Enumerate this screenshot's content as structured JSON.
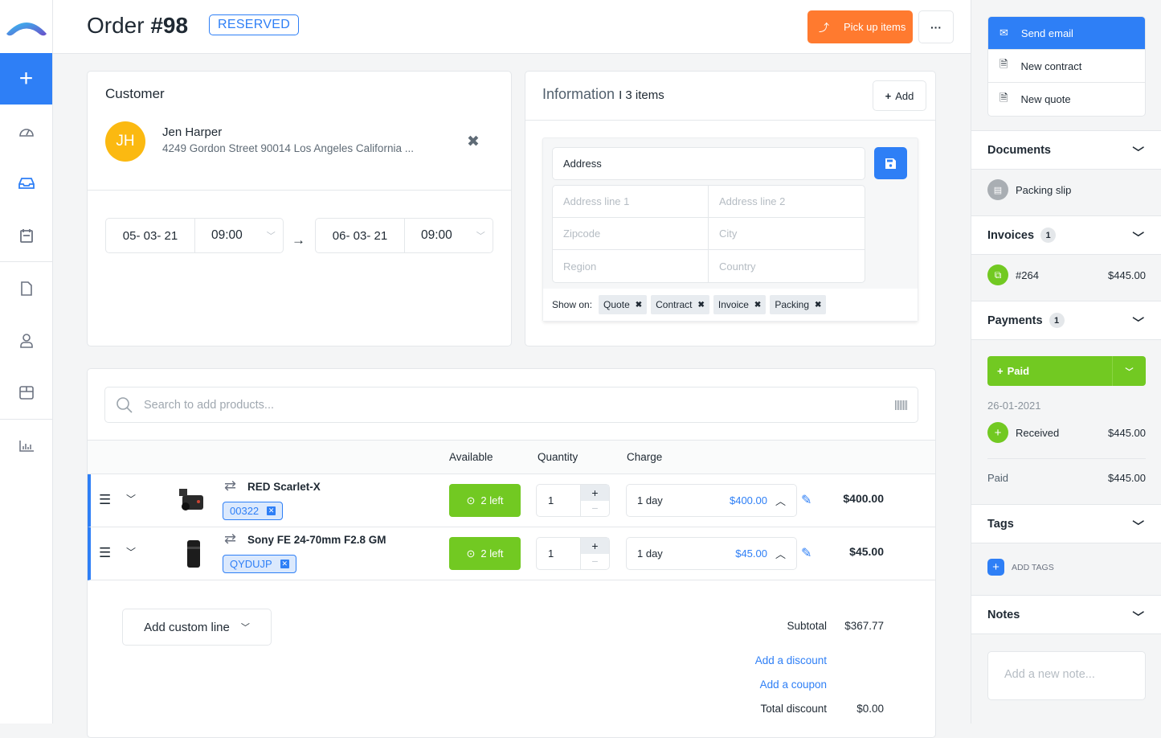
{
  "header": {
    "title_prefix": "Order",
    "title_number": "#98",
    "status": "RESERVED",
    "pickup_label": "Pick up items",
    "more_label": "···"
  },
  "sidebar": {
    "new_label": "+",
    "items": [
      "dashboard",
      "orders",
      "calendar",
      "documents",
      "customers",
      "inventory",
      "reports"
    ]
  },
  "customer": {
    "title": "Customer",
    "initials": "JH",
    "name": "Jen Harper",
    "address": "4249 Gordon Street 90014 Los Angeles California ...",
    "start_date": "05- 03- 21",
    "start_time": "09:00",
    "end_date": "06- 03- 21",
    "end_time": "09:00"
  },
  "information": {
    "title": "Information",
    "count": "I 3 items",
    "add_label": "Add",
    "address_label": "Address",
    "fields": {
      "line1": "Address line 1",
      "line2": "Address line 2",
      "zip": "Zipcode",
      "city": "City",
      "region": "Region",
      "country": "Country"
    },
    "show_on_label": "Show on:",
    "chips": [
      "Quote",
      "Contract",
      "Invoice",
      "Packing"
    ]
  },
  "products": {
    "search_placeholder": "Search to add products...",
    "columns": {
      "available": "Available",
      "quantity": "Quantity",
      "charge": "Charge"
    },
    "rows": [
      {
        "name": "RED Scarlet-X",
        "code": "00322",
        "available": "2 left",
        "quantity": "1",
        "period": "1 day",
        "price": "$400.00",
        "total": "$400.00"
      },
      {
        "name": "Sony FE 24-70mm F2.8 GM",
        "code": "QYDUJP",
        "available": "2 left",
        "quantity": "1",
        "period": "1 day",
        "price": "$45.00",
        "total": "$45.00"
      }
    ],
    "custom_line": "Add custom line",
    "subtotal_label": "Subtotal",
    "subtotal": "$367.77",
    "add_discount": "Add a discount",
    "add_coupon": "Add a coupon",
    "total_discount_label": "Total discount",
    "total_discount": "$0.00"
  },
  "right": {
    "actions": [
      "Send email",
      "New contract",
      "New quote"
    ],
    "documents": {
      "title": "Documents",
      "item": "Packing slip"
    },
    "invoices": {
      "title": "Invoices",
      "count": "1",
      "number": "#264",
      "amount": "$445.00"
    },
    "payments": {
      "title": "Payments",
      "count": "1",
      "paid_button": "Paid",
      "date": "26-01-2021",
      "received_label": "Received",
      "received_amount": "$445.00",
      "paid_label": "Paid",
      "paid_amount": "$445.00"
    },
    "tags": {
      "title": "Tags",
      "add_label": "ADD TAGS"
    },
    "notes": {
      "title": "Notes",
      "placeholder": "Add a new note..."
    }
  },
  "colors": {
    "primary": "#2e7ff6",
    "orange": "#ff7a2f",
    "green": "#72c922",
    "avatar": "#fbb911"
  }
}
